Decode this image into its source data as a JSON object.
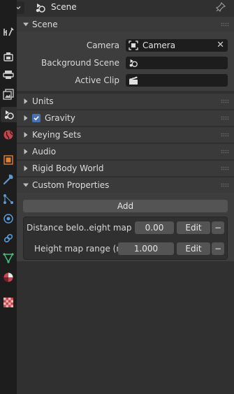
{
  "header": {
    "context_label": "Scene"
  },
  "panels": {
    "scene": {
      "title": "Scene",
      "camera_label": "Camera",
      "camera_value": "Camera",
      "background_scene_label": "Background Scene",
      "background_scene_value": "",
      "active_clip_label": "Active Clip",
      "active_clip_value": ""
    },
    "units": {
      "title": "Units"
    },
    "gravity": {
      "title": "Gravity",
      "checked": true
    },
    "keying_sets": {
      "title": "Keying Sets"
    },
    "audio": {
      "title": "Audio"
    },
    "rigid_body_world": {
      "title": "Rigid Body World"
    },
    "custom_properties": {
      "title": "Custom Properties",
      "add_label": "Add",
      "properties": [
        {
          "name": "Distance belo..eight map (m)",
          "value": "0.00",
          "edit_label": "Edit",
          "remove_label": "−"
        },
        {
          "name": "Height map range (m)",
          "value": "1.000",
          "edit_label": "Edit",
          "remove_label": "−"
        }
      ]
    }
  },
  "sidebar_tabs": [
    "tool-icon",
    "render-icon",
    "output-icon",
    "view-layer-icon",
    "scene-icon",
    "world-icon",
    "object-icon",
    "modifier-icon",
    "particles-icon",
    "physics-icon",
    "constraints-icon",
    "object-data-icon",
    "material-icon",
    "texture-icon"
  ],
  "colors": {
    "accent_blue": "#4772b3",
    "background": "#303030",
    "panel": "#3d3d3d",
    "sidebar": "#1d1d1d"
  }
}
